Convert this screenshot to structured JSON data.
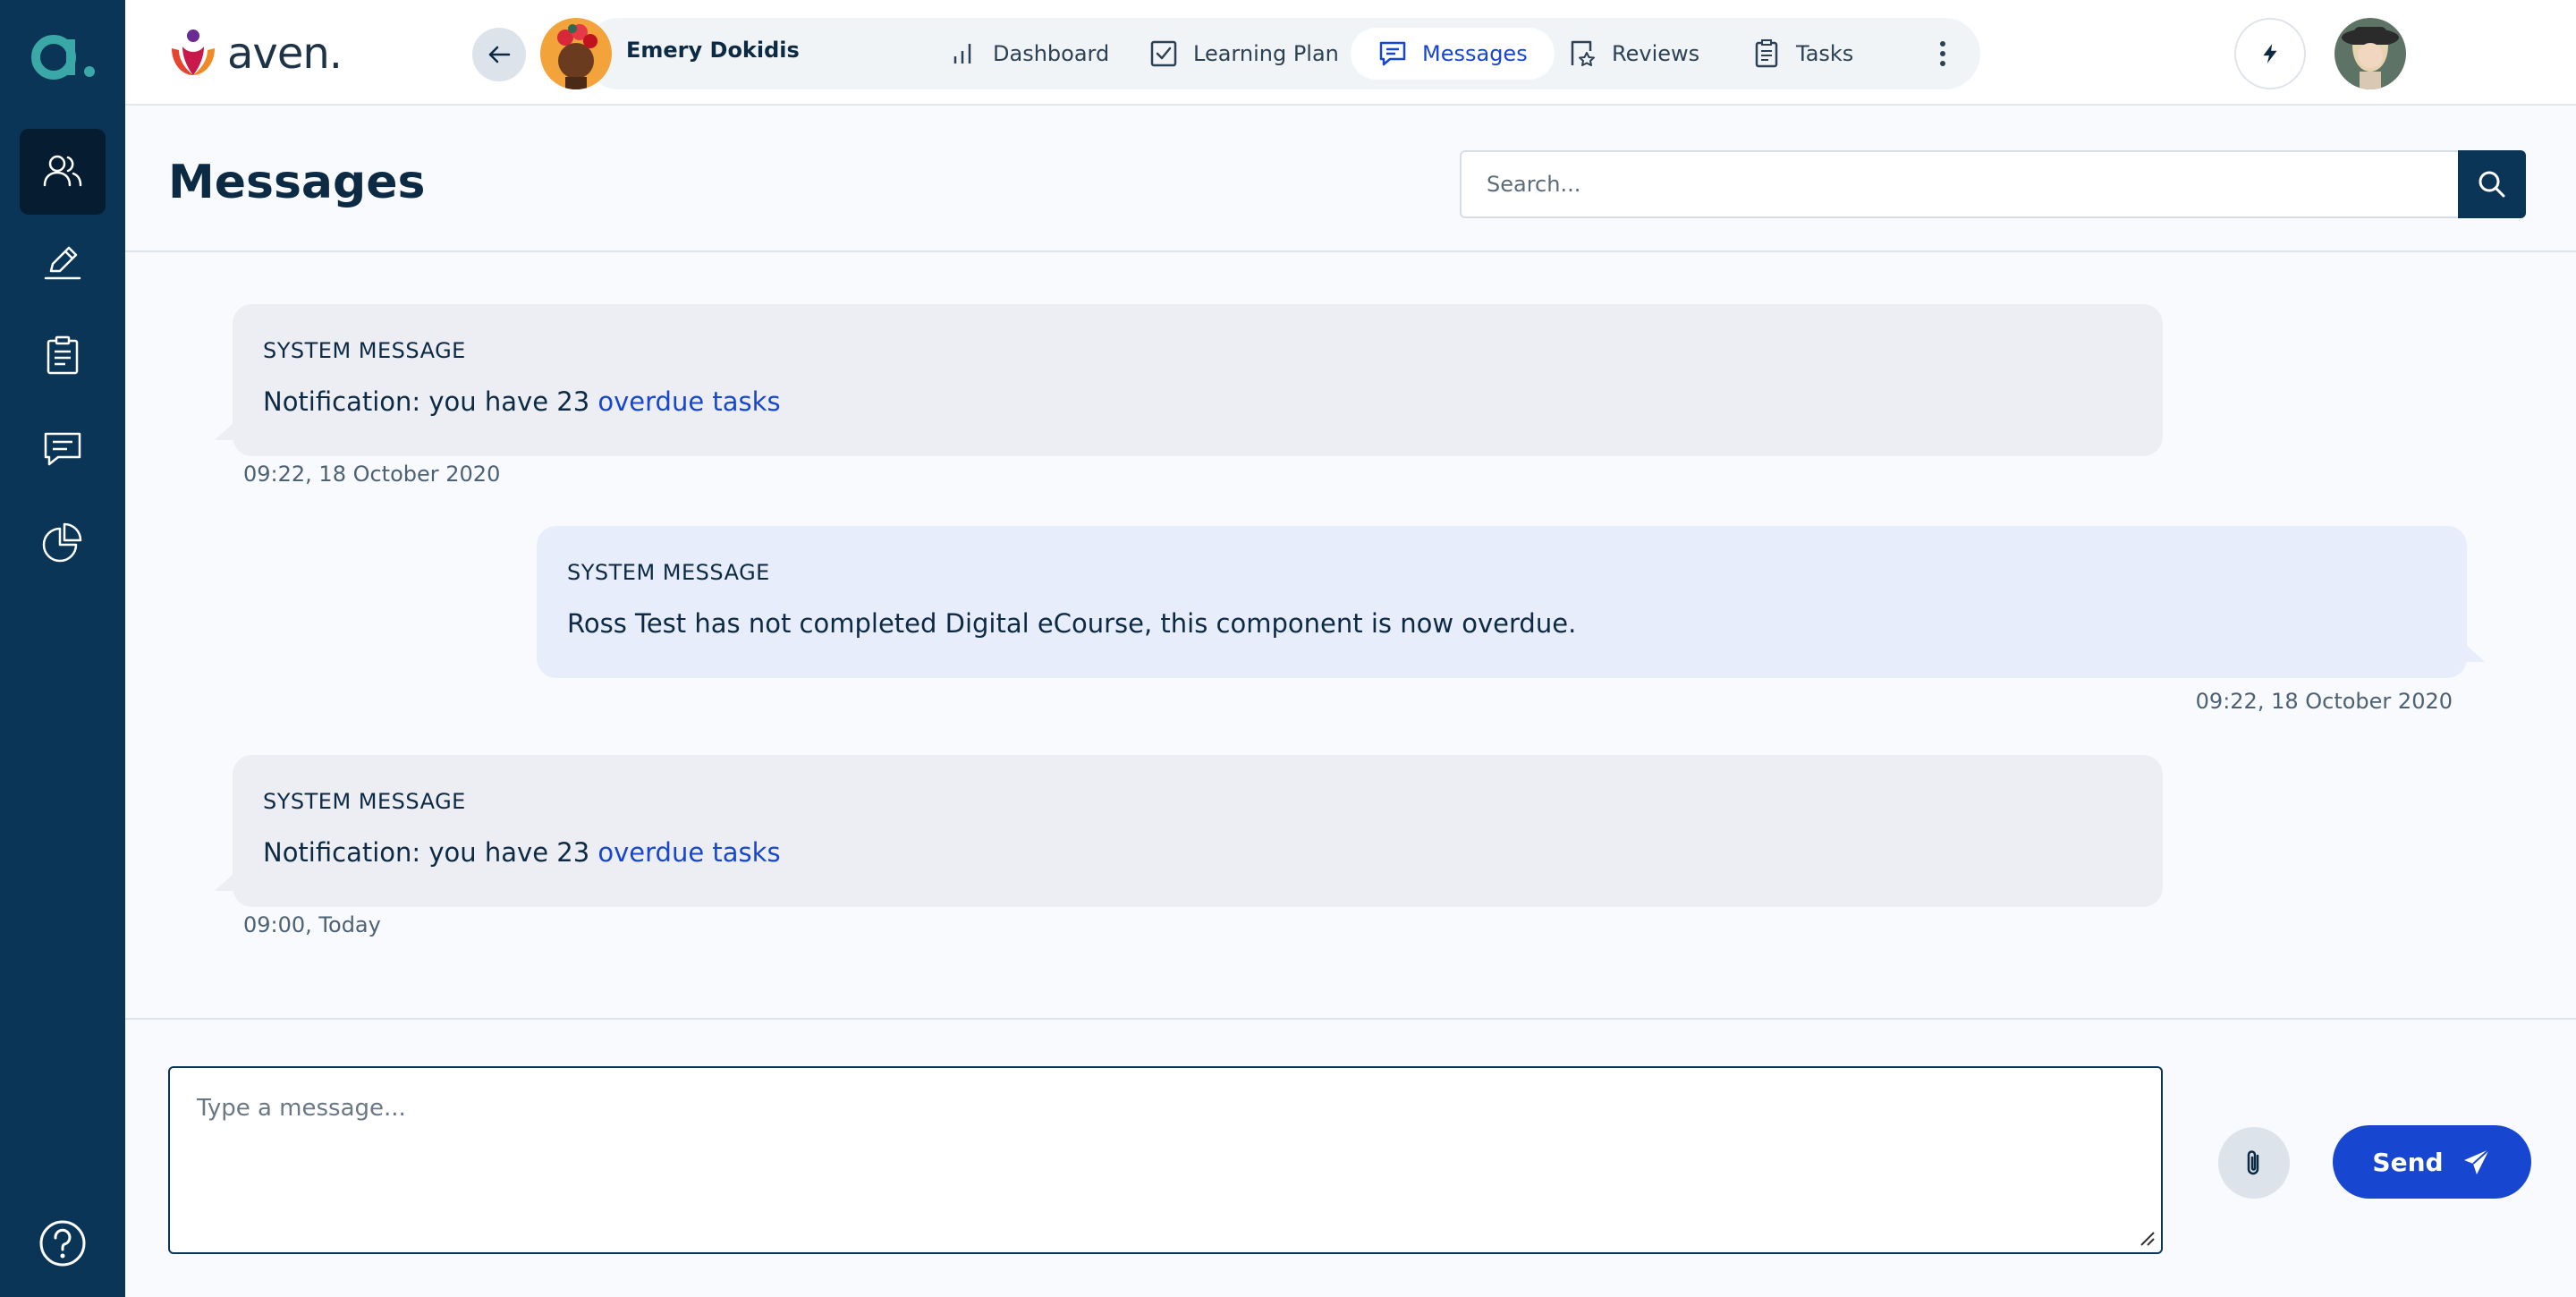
{
  "app": {
    "brand_name": "aven.",
    "rail_logo_letter": "a"
  },
  "nav": {
    "user_name": "Emery Dokidis",
    "tabs": [
      {
        "label": "Dashboard",
        "icon": "bar-chart-icon",
        "active": false
      },
      {
        "label": "Learning Plan",
        "icon": "checkbox-icon",
        "active": false
      },
      {
        "label": "Messages",
        "icon": "chat-icon",
        "active": true
      },
      {
        "label": "Reviews",
        "icon": "review-icon",
        "active": false
      },
      {
        "label": "Tasks",
        "icon": "clipboard-icon",
        "active": false
      }
    ]
  },
  "sidebar": {
    "items": [
      {
        "name": "users",
        "icon": "users-icon",
        "active": true
      },
      {
        "name": "edit",
        "icon": "pen-icon",
        "active": false
      },
      {
        "name": "tasks",
        "icon": "clipboard-icon",
        "active": false
      },
      {
        "name": "messages",
        "icon": "chat-icon",
        "active": false
      },
      {
        "name": "reports",
        "icon": "pie-chart-icon",
        "active": false
      }
    ],
    "help_icon": "help-icon"
  },
  "page": {
    "title": "Messages",
    "search_placeholder": "Search..."
  },
  "messages": [
    {
      "direction": "in",
      "label": "SYSTEM MESSAGE",
      "text_before": "Notification: you have 23 ",
      "link": "overdue tasks",
      "time": "09:22, 18 October 2020"
    },
    {
      "direction": "out",
      "label": "SYSTEM MESSAGE",
      "text_before": "Ross Test has not completed Digital eCourse, this component is now overdue.",
      "link": "",
      "time": "09:22, 18 October 2020"
    },
    {
      "direction": "in",
      "label": "SYSTEM MESSAGE",
      "text_before": "Notification: you have 23 ",
      "link": "overdue tasks",
      "time": "09:00, Today"
    }
  ],
  "composer": {
    "placeholder": "Type a message...",
    "send_label": "Send"
  },
  "colors": {
    "sidebar_bg": "#0b3556",
    "accent": "#1746d1",
    "incoming_bubble": "#eceef4",
    "outgoing_bubble": "#e8edfc"
  }
}
